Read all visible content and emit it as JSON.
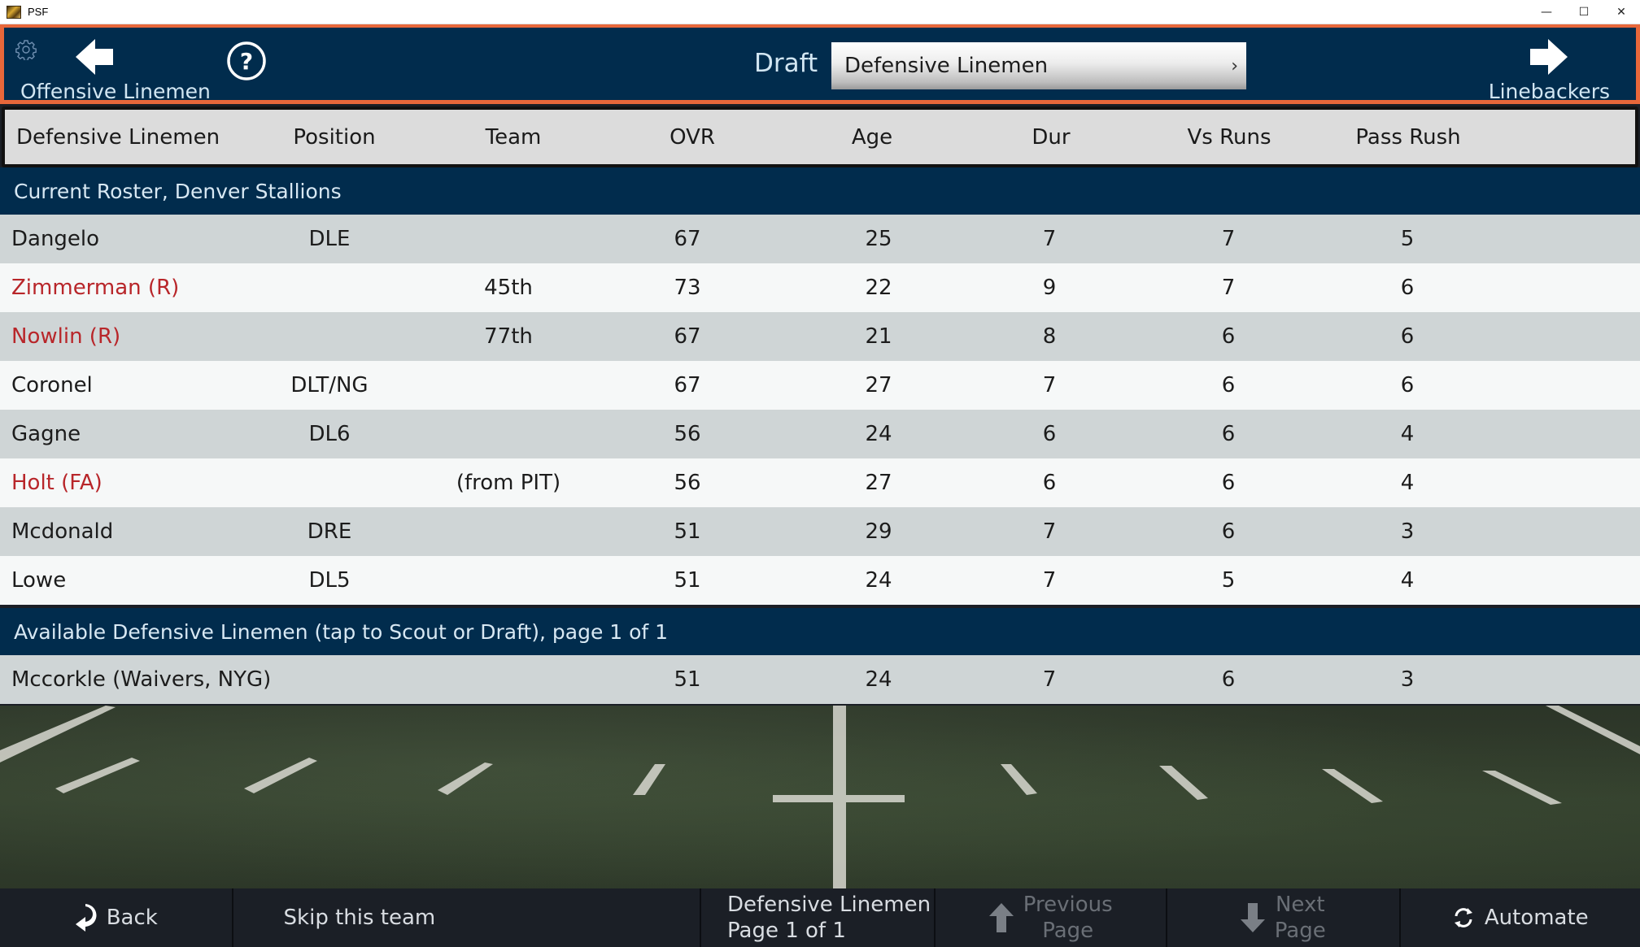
{
  "window": {
    "title": "PSF",
    "controls": {
      "minimize": "—",
      "maximize": "☐",
      "close": "✕"
    }
  },
  "header": {
    "settings_icon": "gear-icon",
    "prev_nav": {
      "label": "Offensive Linemen",
      "icon": "arrow-left-icon"
    },
    "help_icon": "help-icon",
    "draft_label": "Draft",
    "position_select": {
      "value": "Defensive Linemen",
      "chevron": "›"
    },
    "next_nav": {
      "label": "Linebackers",
      "icon": "arrow-right-icon"
    }
  },
  "table": {
    "columns": [
      "Defensive Linemen",
      "Position",
      "Team",
      "OVR",
      "Age",
      "Dur",
      "Vs Runs",
      "Pass Rush"
    ],
    "roster_section": "Current Roster, Denver Stallions",
    "roster": [
      {
        "name": "Dangelo",
        "highlight": false,
        "position": "DLE",
        "team": "",
        "ovr": "67",
        "age": "25",
        "dur": "7",
        "vs_runs": "7",
        "pass_rush": "5"
      },
      {
        "name": "Zimmerman (R)",
        "highlight": true,
        "position": "",
        "team": "45th",
        "ovr": "73",
        "age": "22",
        "dur": "9",
        "vs_runs": "7",
        "pass_rush": "6"
      },
      {
        "name": "Nowlin (R)",
        "highlight": true,
        "position": "",
        "team": "77th",
        "ovr": "67",
        "age": "21",
        "dur": "8",
        "vs_runs": "6",
        "pass_rush": "6"
      },
      {
        "name": "Coronel",
        "highlight": false,
        "position": "DLT/NG",
        "team": "",
        "ovr": "67",
        "age": "27",
        "dur": "7",
        "vs_runs": "6",
        "pass_rush": "6"
      },
      {
        "name": "Gagne",
        "highlight": false,
        "position": "DL6",
        "team": "",
        "ovr": "56",
        "age": "24",
        "dur": "6",
        "vs_runs": "6",
        "pass_rush": "4"
      },
      {
        "name": "Holt (FA)",
        "highlight": true,
        "position": "",
        "team": "(from PIT)",
        "ovr": "56",
        "age": "27",
        "dur": "6",
        "vs_runs": "6",
        "pass_rush": "4"
      },
      {
        "name": "Mcdonald",
        "highlight": false,
        "position": "DRE",
        "team": "",
        "ovr": "51",
        "age": "29",
        "dur": "7",
        "vs_runs": "6",
        "pass_rush": "3"
      },
      {
        "name": "Lowe",
        "highlight": false,
        "position": "DL5",
        "team": "",
        "ovr": "51",
        "age": "24",
        "dur": "7",
        "vs_runs": "5",
        "pass_rush": "4"
      }
    ],
    "available_section": "Available Defensive Linemen (tap to Scout or Draft), page 1 of 1",
    "available": [
      {
        "name": "Mccorkle (Waivers, NYG)",
        "highlight": false,
        "position": "",
        "team": "",
        "ovr": "51",
        "age": "24",
        "dur": "7",
        "vs_runs": "6",
        "pass_rush": "3"
      }
    ]
  },
  "toolbar": {
    "back": "Back",
    "skip": "Skip this team",
    "page_info_line1": "Defensive Linemen",
    "page_info_line2": "Page 1 of 1",
    "prev_page_line1": "Previous",
    "prev_page_line2": "Page",
    "next_page_line1": "Next",
    "next_page_line2": "Page",
    "automate": "Automate"
  },
  "colors": {
    "header_bg": "#012c4d",
    "header_border": "#e8673a",
    "highlight_text": "#b8262a",
    "row_odd": "#cfd5d6",
    "row_even": "#f6f8f8",
    "toolbar_bg": "#1b1f26"
  }
}
